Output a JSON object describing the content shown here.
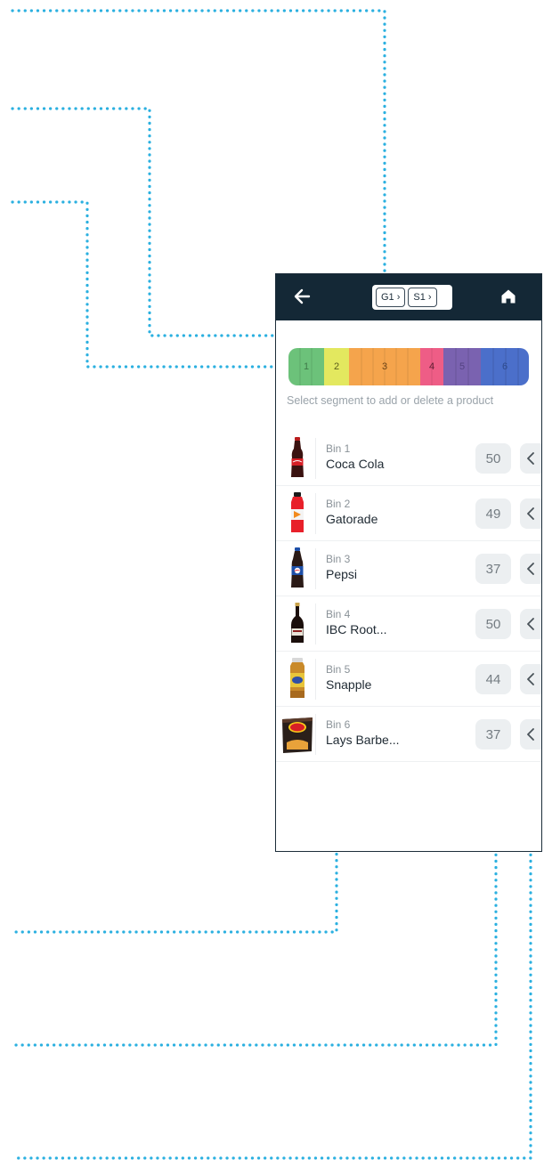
{
  "header": {
    "breadcrumbs": [
      "G1 ›",
      "S1 ›"
    ],
    "back_icon": "arrow-left-icon",
    "home_icon": "home-icon"
  },
  "segment_bar": {
    "segments": [
      {
        "label": "1",
        "color": "#6cc27a"
      },
      {
        "label": "2",
        "color": "#e3e85f"
      },
      {
        "label": "3",
        "color": "#f5a44c"
      },
      {
        "label": "4",
        "color": "#ee5d86"
      },
      {
        "label": "5",
        "color": "#7a62b0"
      },
      {
        "label": "6",
        "color": "#4b6fca"
      }
    ],
    "hint": "Select segment to add or delete a product"
  },
  "products": [
    {
      "bin": "Bin 1",
      "name": "Coca Cola",
      "count": "50"
    },
    {
      "bin": "Bin 2",
      "name": "Gatorade",
      "count": "49"
    },
    {
      "bin": "Bin 3",
      "name": "Pepsi",
      "count": "37"
    },
    {
      "bin": "Bin 4",
      "name": "IBC Root...",
      "count": "50"
    },
    {
      "bin": "Bin 5",
      "name": "Snapple",
      "count": "44"
    },
    {
      "bin": "Bin 6",
      "name": "Lays Barbe...",
      "count": "37"
    }
  ],
  "colors": {
    "header_bg": "#142836",
    "connector": "#2bb0e0"
  }
}
